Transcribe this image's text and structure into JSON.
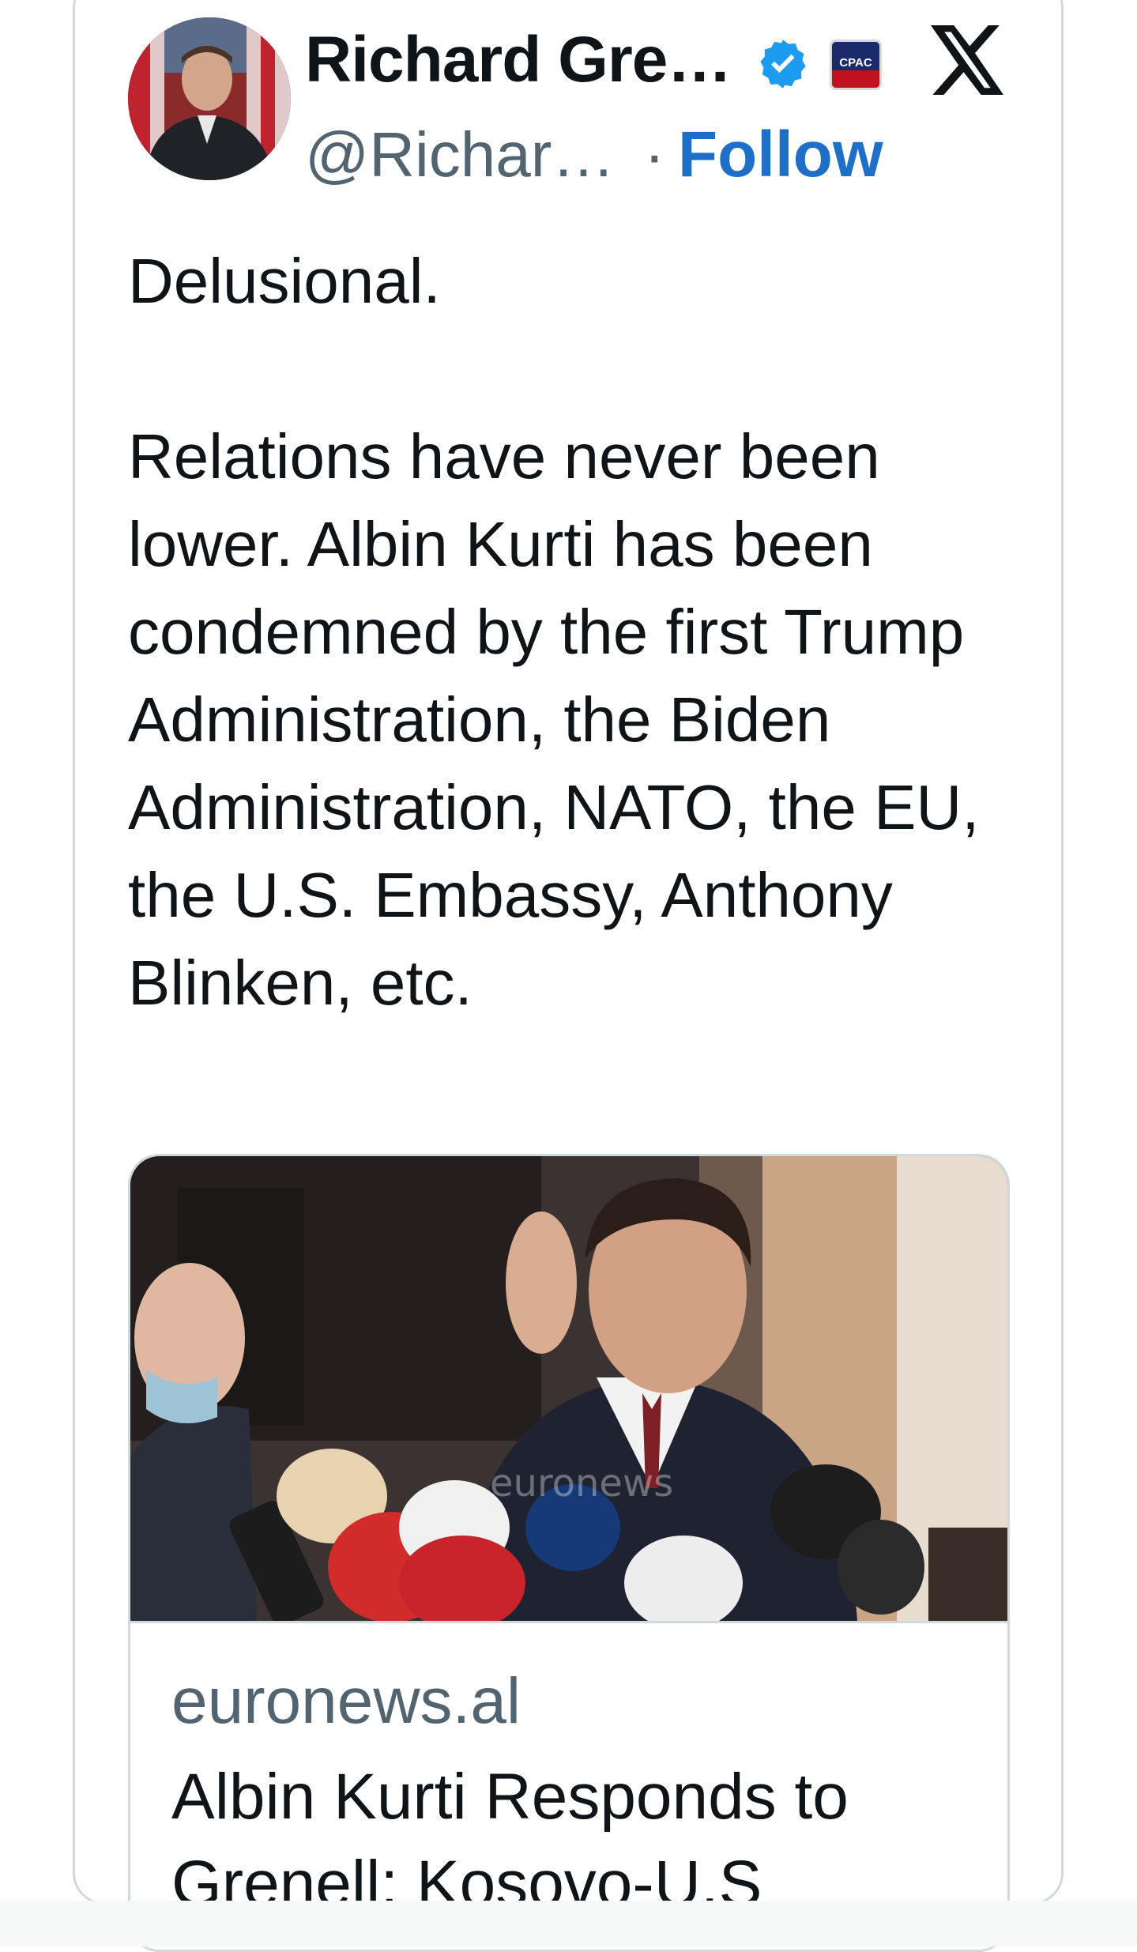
{
  "tweet": {
    "author": {
      "display_name": "Richard Gre…",
      "handle": "@Richar…",
      "separator": "·",
      "follow_label": "Follow",
      "verified_icon": "verified-badge-icon",
      "affiliation_badge": "CPAC"
    },
    "platform_icon": "x-logo-icon",
    "text_paragraphs": [
      "Delusional.",
      "Relations have never been lower. Albin Kurti has been condemned by the first Trump Administration, the Biden Administration, NATO, the EU, the U.S. Embassy, Anthony Blinken, etc."
    ],
    "link_card": {
      "domain": "euronews.al",
      "title": "Albin Kurti Responds to Grenell: Kosovo-U.S"
    }
  },
  "colors": {
    "text": "#0f1419",
    "secondary_text": "#536471",
    "link_blue": "#1d6fc7",
    "verified_blue": "#1d9bf0",
    "border": "#cfd9de"
  }
}
